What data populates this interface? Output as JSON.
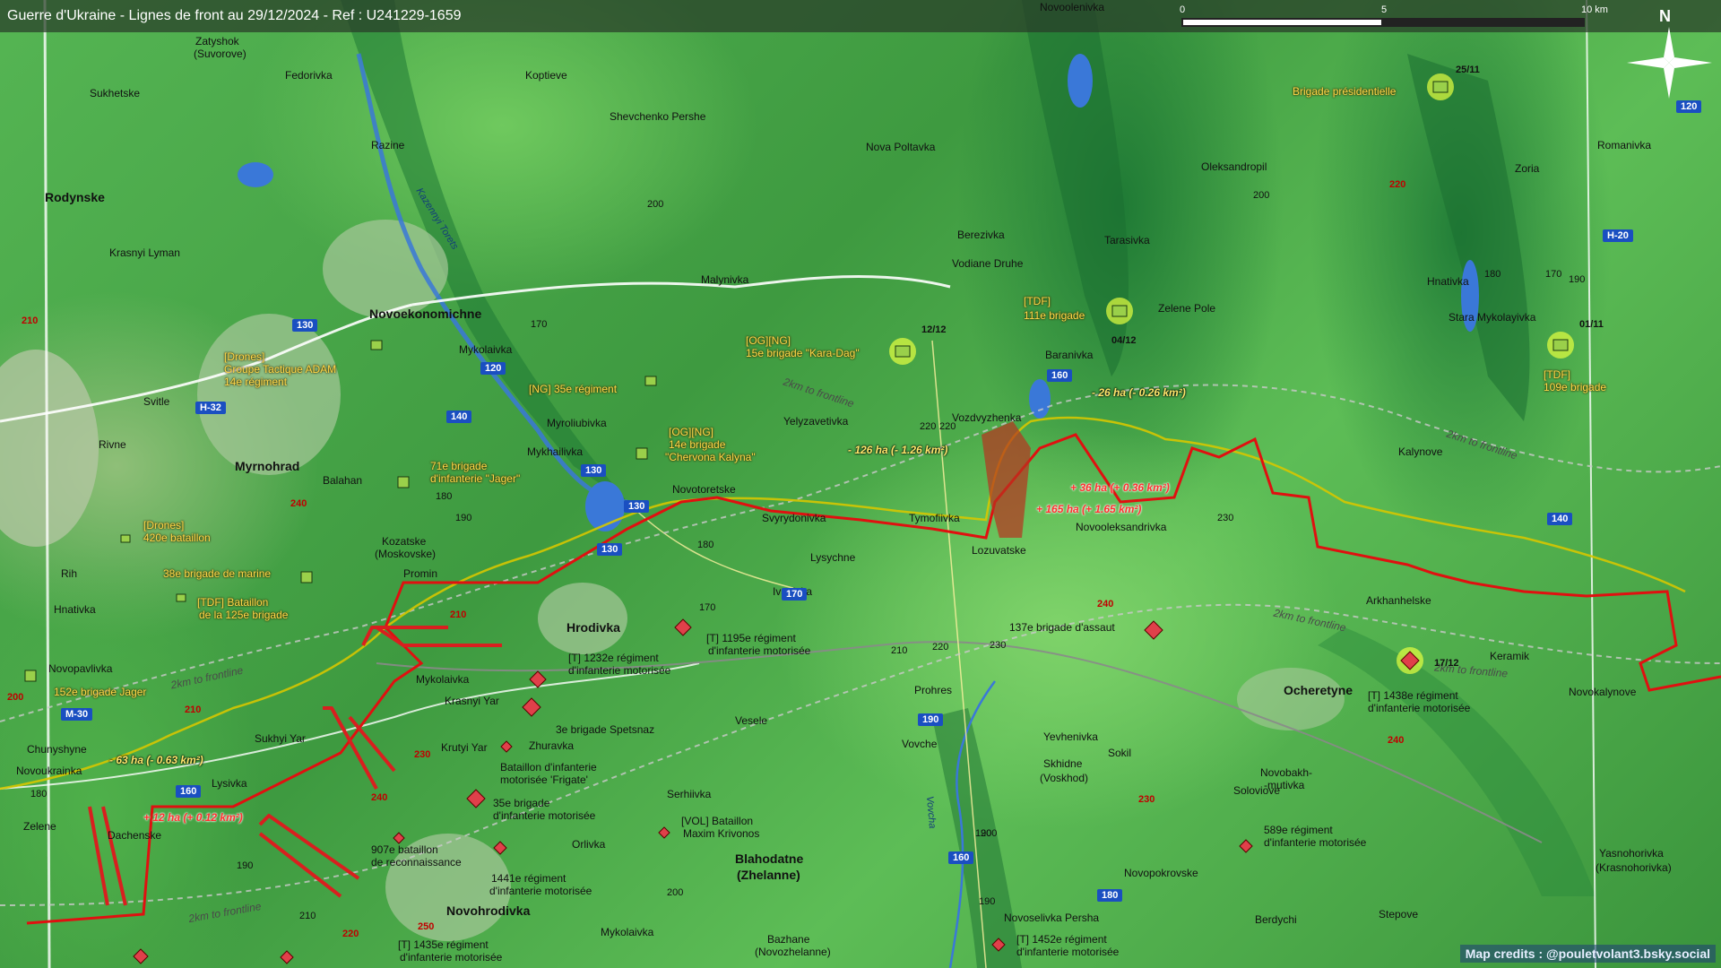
{
  "header": {
    "title": "Guerre d'Ukraine - Lignes de front au 29/12/2024 - Ref : U241229-1659",
    "scale": {
      "zero": "0",
      "mid": "5",
      "end": "10 km"
    },
    "north": "N"
  },
  "credit": "Map credits : @pouletvolant3.bsky.social",
  "colors": {
    "frontline": "#e01010",
    "old_line": "#d6c600",
    "friendly": "#c9e84a",
    "enemy": "#e0404a",
    "road": "#ffffff",
    "water": "#3a78d8"
  },
  "places": {
    "rodynske": "Rodynske",
    "zatyshok": "Zatyshok",
    "suvorove": "(Suvorove)",
    "fedorivka": "Fedorivka",
    "sukhetske": "Sukhetske",
    "razine": "Razine",
    "krasnyi_lyman": "Krasnyi Lyman",
    "koptieve": "Koptieve",
    "shevchenko": "Shevchenko Pershe",
    "novoolenivka": "Novoolenivka",
    "nova_poltavka": "Nova Poltavka",
    "oleksandropil": "Oleksandropil",
    "romanivka": "Romanivka",
    "zoria": "Zoria",
    "berezivka": "Berezivka",
    "vodiane_druhe": "Vodiane Druhe",
    "tarasivka": "Tarasivka",
    "malynivka": "Malynivka",
    "zelene_pole": "Zelene Pole",
    "hnativka_n": "Hnativka",
    "stara_mykolayivka": "Stara Mykolayivka",
    "novoekonomichne": "Novoekonomichne",
    "mykolaivka_n": "Mykolaivka",
    "svitle": "Svitle",
    "rivne": "Rivne",
    "myrnohrad": "Myrnohrad",
    "balahan": "Balahan",
    "myroliubivka": "Myroliubivka",
    "mykhailivka": "Mykhailivka",
    "yelyzavetivka": "Yelyzavetivka",
    "baranivka": "Baranivka",
    "vozdvyzhenka": "Vozdvyzhenka",
    "kalynove": "Kalynove",
    "novotoretske": "Novotoretske",
    "svyrydonivka": "Svyrydonivka",
    "tymofiivka": "Tymofiivka",
    "lozuvatske": "Lozuvatske",
    "novooleksandrivka": "Novooleksandrivka",
    "kozatske": "Kozatske",
    "moskovske": "(Moskovske)",
    "promin": "Promin",
    "rih": "Rih",
    "hnativka_w": "Hnativka",
    "lysychne": "Lysychne",
    "ivanivka": "Ivanivka",
    "hrodivka": "Hrodivka",
    "arkhanhelske": "Arkhanhelske",
    "keramik": "Keramik",
    "novokalynove": "Novokalynove",
    "ocheretyne": "Ocheretyne",
    "novopavlivka": "Novopavlivka",
    "mykolaivka_s": "Mykolaivka",
    "krasnyi_yar": "Krasnyi Yar",
    "prohres": "Prohres",
    "vesele": "Vesele",
    "chunyshyne": "Chunyshyne",
    "sukhyi_yar": "Sukhyi Yar",
    "krutyi_yar": "Krutyi Yar",
    "zhuravka": "Zhuravka",
    "yevhenivka": "Yevhenivka",
    "sokil": "Sokil",
    "novoukrainka": "Novoukrainka",
    "lysivka": "Lysivka",
    "vovche": "Vovche",
    "skhidne": "Skhidne",
    "voskhod": "(Voskhod)",
    "novobakh1": "Novobakh-",
    "novobakh2": "-mutivka",
    "zelene": "Zelene",
    "dachenske": "Dachenske",
    "serhiivka": "Serhiivka",
    "soloviove": "Soloviove",
    "orlivka": "Orlivka",
    "blahodatne": "Blahodatne",
    "zhelanne": "(Zhelanne)",
    "novopokrovske": "Novopokrovske",
    "yasnohorivka": "Yasnohorivka",
    "krasnohorivka": "(Krasnohorivka)",
    "novohrodivka": "Novohrodivka",
    "mykolaivka_ss": "Mykolaivka",
    "novoselivka": "Novoselivka Persha",
    "berdychi": "Berdychi",
    "stepove": "Stepove",
    "bazhane": "Bazhane",
    "novozhelanne": "(Novozhelanne)"
  },
  "rivers": {
    "kazennyi": "Kazennyi Torets",
    "vovcha": "Vovcha"
  },
  "roads": {
    "h32": "H-32",
    "h20": "H-20",
    "m30": "M-30",
    "r120a": "120",
    "r120b": "120",
    "r130a": "130",
    "r130b": "130",
    "r130c": "130",
    "r130d": "130",
    "r140a": "140",
    "r140b": "140",
    "r160a": "160",
    "r160b": "160",
    "r160c": "160",
    "r170": "170",
    "r190": "190",
    "r180": "180"
  },
  "elevations": {
    "e210a": "210",
    "e200a": "200",
    "e170a": "170",
    "e190a": "190",
    "e240a": "240",
    "e220a": "220",
    "e210b": "210",
    "e200b": "200",
    "e240b": "240",
    "e230a": "230",
    "e240c": "240",
    "e230b": "230",
    "e210c": "210",
    "e220b": "220",
    "e230c": "230",
    "e200c": "200",
    "e220c": "220",
    "e240d": "240",
    "e230d": "230",
    "e250": "250",
    "e220d": "220",
    "e200d": "200",
    "e210d": "210",
    "e180a": "180",
    "e190b": "190",
    "e190c": "190",
    "e170b": "170",
    "e180b": "180",
    "e180c": "180",
    "e190d": "190",
    "e180d": "180",
    "e170c": "170",
    "e190e": "190",
    "e200e": "200",
    "e210e": "210",
    "e220e": "220"
  },
  "frontline_labels": {
    "f1": "2km to frontline",
    "f2": "2km to frontline",
    "f3": "2km to frontline",
    "f4": "2km to frontline",
    "f5": "2km to frontline",
    "f6": "2km to frontline"
  },
  "changes": {
    "c1": "- 126 ha (- 1.26 km²)",
    "c2": "- 26 ha (- 0.26 km²)",
    "c3": "+ 36 ha (+ 0.36 km²)",
    "c4": "+ 165 ha (+ 1.65 km²)",
    "c5": "- 63 ha (- 0.63 km²)",
    "c6": "+ 12 ha (+ 0.12 km²)"
  },
  "dates": {
    "d1": "25/11",
    "d2": "12/12",
    "d3": "04/12",
    "d4": "01/11",
    "d5": "17/12"
  },
  "units_friendly": {
    "u1": "Brigade présidentielle",
    "u2a": "[OG][NG]",
    "u2b": "15e brigade \"Kara-Dag\"",
    "u3a": "[TDF]",
    "u3b": "111e brigade",
    "u4a": "[TDF]",
    "u4b": "109e brigade",
    "u5a": "[Drones]",
    "u5b": "Groupe Tactique ADAM",
    "u5c": "14e régiment",
    "u6": "[NG] 35e régiment",
    "u7a": "[OG][NG]",
    "u7b": "14e brigade",
    "u7c": "\"Chervona Kalyna\"",
    "u8a": "71e brigade",
    "u8b": "d'infanterie \"Jager\"",
    "u9a": "[Drones]",
    "u9b": "420e bataillon",
    "u10": "38e brigade de marine",
    "u11a": "[TDF] Bataillon",
    "u11b": "de la 125e brigade",
    "u12": "152e brigade Jager"
  },
  "units_enemy": {
    "e1": "137e brigade d'assaut",
    "e2a": "[T] 1195e régiment",
    "e2b": "d'infanterie motorisée",
    "e3a": "[T] 1232e régiment",
    "e3b": "d'infanterie motorisée",
    "e4": "3e brigade Spetsnaz",
    "e5a": "Bataillon d'infanterie",
    "e5b": "motorisée 'Frigate'",
    "e6a": "35e brigade",
    "e6b": "d'infanterie motorisée",
    "e7a": "[VOL] Bataillon",
    "e7b": "Maxim Krivonos",
    "e8a": "907e bataillon",
    "e8b": "de reconnaissance",
    "e9a": "1441e régiment",
    "e9b": "d'infanterie motorisée",
    "e10a": "[T] 1438e régiment",
    "e10b": "d'infanterie motorisée",
    "e11a": "589e régiment",
    "e11b": "d'infanterie motorisée",
    "e12a": "[T] 1435e régiment",
    "e12b": "d'infanterie motorisée",
    "e13a": "[T] 1452e régiment",
    "e13b": "d'infanterie motorisée"
  }
}
